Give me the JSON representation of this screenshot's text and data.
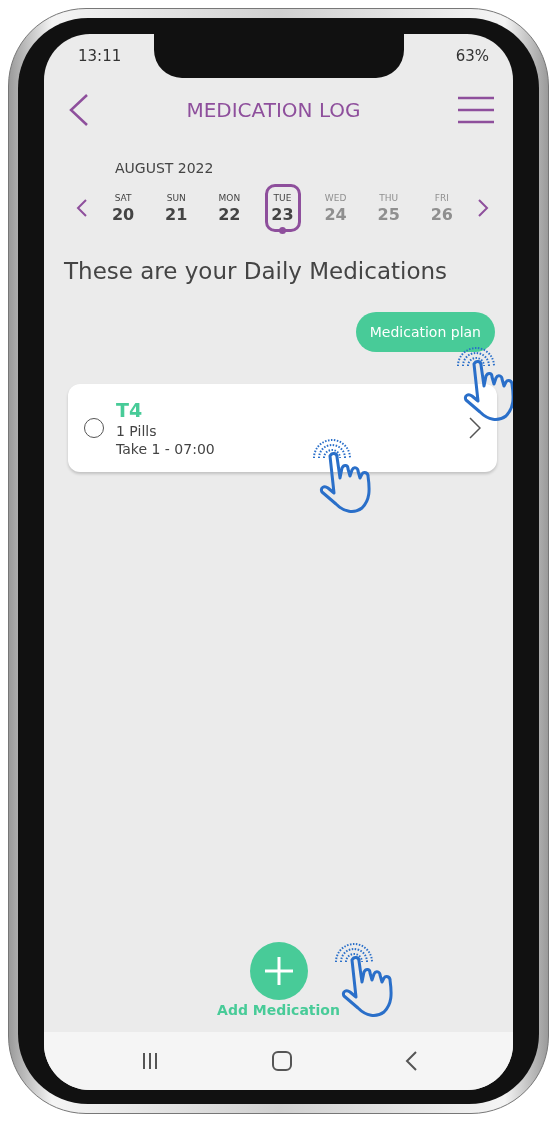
{
  "status_bar": {
    "time": "13:11",
    "battery": "63%"
  },
  "header": {
    "title": "MEDICATION LOG"
  },
  "calendar": {
    "month": "AUGUST 2022",
    "days": [
      {
        "weekday": "SAT",
        "day": "20",
        "selected": false,
        "disabled": false
      },
      {
        "weekday": "SUN",
        "day": "21",
        "selected": false,
        "disabled": false
      },
      {
        "weekday": "MON",
        "day": "22",
        "selected": false,
        "disabled": false
      },
      {
        "weekday": "TUE",
        "day": "23",
        "selected": true,
        "disabled": false
      },
      {
        "weekday": "WED",
        "day": "24",
        "selected": false,
        "disabled": true
      },
      {
        "weekday": "THU",
        "day": "25",
        "selected": false,
        "disabled": true
      },
      {
        "weekday": "FRI",
        "day": "26",
        "selected": false,
        "disabled": true
      }
    ]
  },
  "heading": "These are your Daily Medications",
  "plan_button": "Medication plan",
  "medications": [
    {
      "name": "T4",
      "amount": "1 Pills",
      "schedule": "Take 1 - 07:00",
      "checked": false
    }
  ],
  "add_button": {
    "label": "Add Medication"
  }
}
